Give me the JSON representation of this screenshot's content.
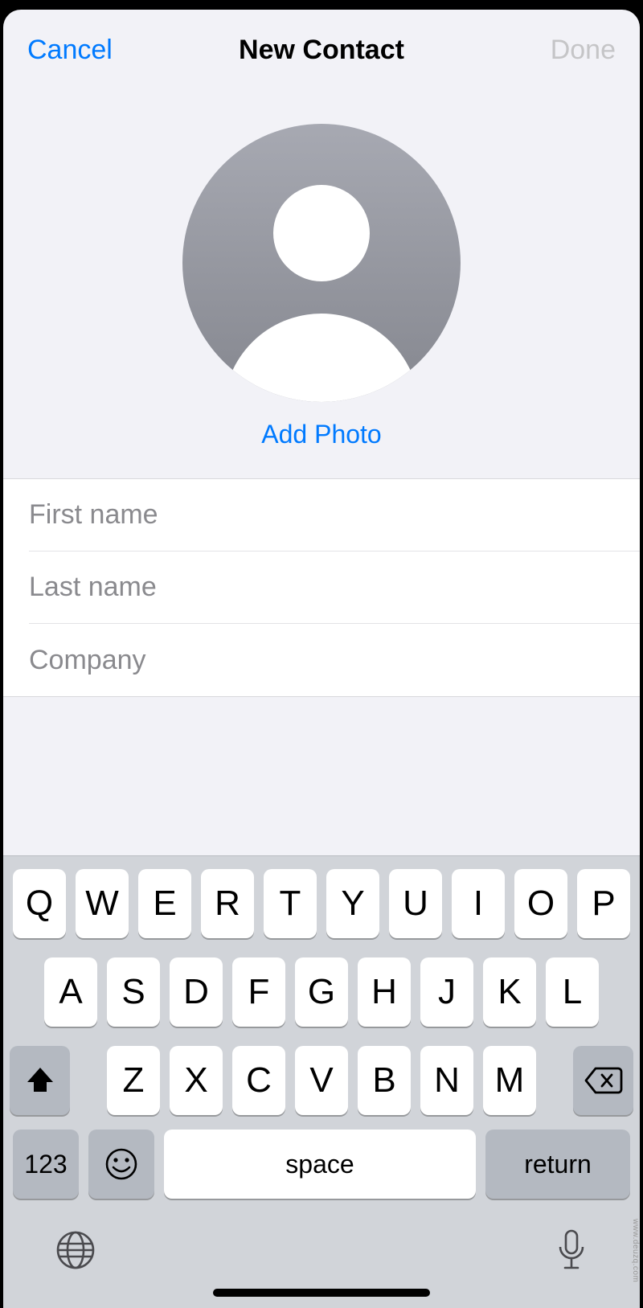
{
  "nav": {
    "cancel": "Cancel",
    "title": "New Contact",
    "done": "Done"
  },
  "photo": {
    "addPhotoLabel": "Add Photo"
  },
  "fields": {
    "firstNamePlaceholder": "First name",
    "lastNamePlaceholder": "Last name",
    "companyPlaceholder": "Company",
    "firstNameValue": "",
    "lastNameValue": "",
    "companyValue": ""
  },
  "keyboard": {
    "row1": [
      "Q",
      "W",
      "E",
      "R",
      "T",
      "Y",
      "U",
      "I",
      "O",
      "P"
    ],
    "row2": [
      "A",
      "S",
      "D",
      "F",
      "G",
      "H",
      "J",
      "K",
      "L"
    ],
    "row3": [
      "Z",
      "X",
      "C",
      "V",
      "B",
      "N",
      "M"
    ],
    "numKey": "123",
    "space": "space",
    "return": "return"
  },
  "watermark": "www.deuzq.com"
}
